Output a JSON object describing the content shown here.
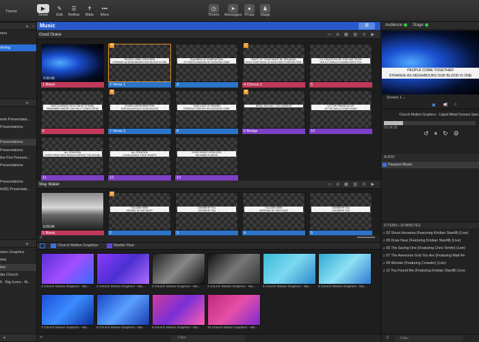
{
  "toolbar": {
    "theme": "Theme",
    "left_btns": [
      {
        "label": "Show",
        "icon": "play-icon"
      },
      {
        "label": "Edit",
        "icon": "pencil-icon"
      },
      {
        "label": "Reflow",
        "icon": "reflow-icon"
      },
      {
        "label": "Bible",
        "icon": "bible-icon"
      },
      {
        "label": "More",
        "icon": "more-icon"
      }
    ],
    "right_btns": [
      {
        "label": "Timers"
      },
      {
        "label": "Messages"
      },
      {
        "label": "Props"
      },
      {
        "label": "Stage"
      }
    ]
  },
  "left": {
    "rows1": [
      "ions",
      "orning"
    ],
    "rows2": [
      "ents  Presentatio...",
      "Presentations",
      "",
      "Presentations",
      "Presentations",
      "the Fire  Present...",
      "Presentations"
    ],
    "rows3": [
      "Presentations",
      "ASB)  Presentati..."
    ],
    "rows4": [
      "otion Graphics",
      "etal",
      "low",
      "dia Church",
      "5 - Big Icons - M..."
    ]
  },
  "main": {
    "title": "Music",
    "playlist1": "Good Grace",
    "playlist2": "Way Maker",
    "media_tabs": [
      "Church Motion Graphics",
      "Marble Flow"
    ],
    "filter": "Filter",
    "gg": [
      {
        "n": "1",
        "label": "Blank",
        "color": "#c0395a",
        "time": "0:30.00",
        "kind": "ocean"
      },
      {
        "n": "2",
        "label": "Verse 1",
        "color": "#2b74c7",
        "mark": "A",
        "lines": [
          "PEOPLE COME TOGETHER",
          "STRANGE AS NEIGHBOURS OUR BLOOD IS ONE"
        ],
        "selected": true
      },
      {
        "n": "3",
        "label": "",
        "color": "#2b74c7",
        "lines": [
          "CHILDREN OF GENERATIONS",
          "OF DEATH SHADOW OF KINGDOM COME"
        ]
      },
      {
        "n": "4",
        "label": "Chorus 1",
        "color": "#c0395a",
        "mark": "C",
        "lines": [
          "DON'T LET YOUR HEART BE TROUBLED",
          "HOLD YOUR HEAD UP HIGH DON'T EVER BE FOOL"
        ]
      },
      {
        "n": "5",
        "label": "",
        "color": "#c0395a",
        "lines": [
          "FIX YOUR EYES ON THIS ONE TRUTH",
          "HOLD IT SHALL FLOURISH WITH YOU"
        ]
      },
      {
        "n": "6",
        "label": "",
        "color": "#c0395a",
        "lines": [
          "TAKE COURAGE HOLD ON BE STRONG",
          "REMEMBER WHERE OUR HELP COMES FROM"
        ]
      },
      {
        "n": "7",
        "label": "Verse 2",
        "color": "#2b74c7",
        "mark": "B",
        "lines": [
          "JESUS OUR REDEMPTION",
          "OUR SALVATION IS IN HIS BLOOD"
        ]
      },
      {
        "n": "8",
        "label": "",
        "color": "#2b74c7",
        "lines": [
          "TAKE LIGHT OF HEAVEN",
          "FREEING FOREVER HIS KINGDOM COME"
        ]
      },
      {
        "n": "9",
        "label": "Bridge",
        "color": "#7d3fc4",
        "mark": "B",
        "lines": [
          "BRING HIGH ALL YOU HEAVENS"
        ]
      },
      {
        "n": "10",
        "label": "",
        "color": "#7d3fc4",
        "lines": [
          "LET THE PRAISE GO UP",
          "AS THE WALLS COME DOWN"
        ]
      },
      {
        "n": "11",
        "label": "",
        "color": "#7d3fc4",
        "lines": [
          "ALL CREATION",
          "EVERYTHING WITH BREATH REPEAT THE SOUND"
        ]
      },
      {
        "n": "12",
        "label": "",
        "color": "#7d3fc4",
        "lines": [
          "ALL CREATION",
          "CLEAN GRACE PURE HEARTS"
        ]
      },
      {
        "n": "13",
        "label": "",
        "color": "#7d3fc4",
        "lines": [
          "GOOD GRACE GOOD GOD",
          "HIS NAME IS JESUS"
        ]
      }
    ],
    "wm": [
      {
        "n": "1",
        "label": "Blank",
        "color": "#c0395a",
        "time": "0:20.04",
        "kind": "mountain"
      },
      {
        "n": "2",
        "label": "",
        "color": "#2b74c7",
        "mark": "A",
        "lines": [
          "YOU ARE HERE",
          "MOVING IN OUR MIDST"
        ]
      },
      {
        "n": "3",
        "label": "",
        "color": "#2b74c7",
        "lines": [
          "I WORSHIP YOU",
          "I WORSHIP YOU"
        ]
      },
      {
        "n": "4",
        "label": "",
        "color": "#2b74c7",
        "lines": [
          "YOU ARE HERE",
          "WORKING IN THIS PLACE"
        ]
      },
      {
        "n": "5",
        "label": "",
        "color": "#2b74c7",
        "lines": [
          "I WORSHIP YOU",
          "I WORSHIP YOU"
        ]
      }
    ],
    "media": [
      {
        "label": "1 Church Motion Graphics - Ma...",
        "g": "linear-gradient(135deg,#5a2fd6,#a14dff,#3a6bff)"
      },
      {
        "label": "2 Church Motion Graphics - Ma...",
        "g": "linear-gradient(135deg,#8b3bff,#4b2fd0,#b06cff)"
      },
      {
        "label": "3 Church Motion Graphics - Ma...",
        "g": "linear-gradient(135deg,#222,#888,#111)"
      },
      {
        "label": "4 Church Motion Graphics - Ma...",
        "g": "linear-gradient(135deg,#111,#777,#333)"
      },
      {
        "label": "5 Church Motion Graphics - Ma...",
        "g": "linear-gradient(135deg,#3bbcd8,#7bd8f0,#2a86c9)"
      },
      {
        "label": "6 Church Motion Graphics - Ma...",
        "g": "linear-gradient(135deg,#2fa9d2,#8fe0f5,#2f7ad0)"
      },
      {
        "label": "7 Church Motion Graphics - Ma...",
        "g": "linear-gradient(135deg,#1c4fd8,#3b8cff,#0c2f9a)"
      },
      {
        "label": "8 Church Motion Graphics - Ma...",
        "g": "linear-gradient(135deg,#1947c9,#5aa0ff,#1a3bb0)"
      },
      {
        "label": "9 Church Motion Graphics - Ma...",
        "g": "linear-gradient(135deg,#d03c9c,#7a2fd6,#ff5fb0)"
      },
      {
        "label": "10 Church Motion Graphics - Ma...",
        "g": "linear-gradient(135deg,#c02a7a,#e74fa8,#7a2bd0)"
      }
    ]
  },
  "right": {
    "audience": "Audience",
    "stage": "Stage",
    "preview_lines": [
      "PEOPLE COME TOGETHER",
      "STRANGE AS NEIGHBOURS OUR BLOOD IS ONE"
    ],
    "screen": "Screen 1",
    "media_title": "Church Motion Graphics - Liquid Metal Oceans Sam",
    "elapsed": "00:04:28",
    "audio_hdr": "AUDIO",
    "audio_item": "Passion Music",
    "count": "6 ITEMS • 30 MINUTES",
    "songs": [
      "02 Shout Hosanna (Featuring Kristian Stanfill) (Live)",
      "05 Draw Near (Featuring Kristian Stanfill) (Live)",
      "06 The Saving One (Featuring Chris Tomlin) (Live)",
      "07 The Awesome God You Are (Featuring Matt Re",
      "09 Wonder (Featuring Crowder) (Live)",
      "11 You Found Me (Featuring Kristian Stanfill) (Live"
    ],
    "filter": "Filter"
  }
}
